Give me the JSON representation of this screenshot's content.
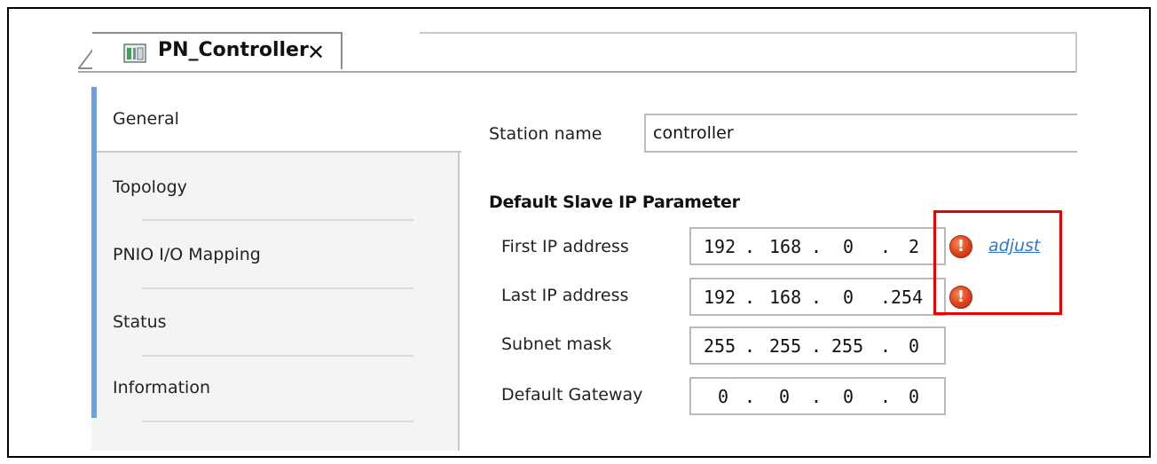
{
  "tab": {
    "title": "PN_Controller",
    "close_glyph": "✕"
  },
  "nav": {
    "items": [
      {
        "label": "General",
        "active": true
      },
      {
        "label": "Topology"
      },
      {
        "label": "PNIO I/O Mapping"
      },
      {
        "label": "Status"
      },
      {
        "label": "Information"
      }
    ]
  },
  "form": {
    "station_name_label": "Station name",
    "station_name_value": "controller",
    "section_title": "Default Slave IP Parameter",
    "fields": [
      {
        "label": "First IP address",
        "octets": [
          "192",
          "168",
          "0",
          "2"
        ],
        "warning": true
      },
      {
        "label": "Last IP address",
        "octets": [
          "192",
          "168",
          "0",
          "254"
        ],
        "warning": true
      },
      {
        "label": "Subnet mask",
        "octets": [
          "255",
          "255",
          "255",
          "0"
        ],
        "warning": false
      },
      {
        "label": "Default Gateway",
        "octets": [
          "0",
          "0",
          "0",
          "0"
        ],
        "warning": false
      }
    ],
    "adjust_link": "adjust"
  },
  "colors": {
    "highlight": "#e60000",
    "accent": "#6fa0dc",
    "link": "#2a78d6",
    "warning": "#e0411a"
  },
  "icons": {
    "tab_icon": "device-icon",
    "warning_icon": "warning-icon"
  }
}
